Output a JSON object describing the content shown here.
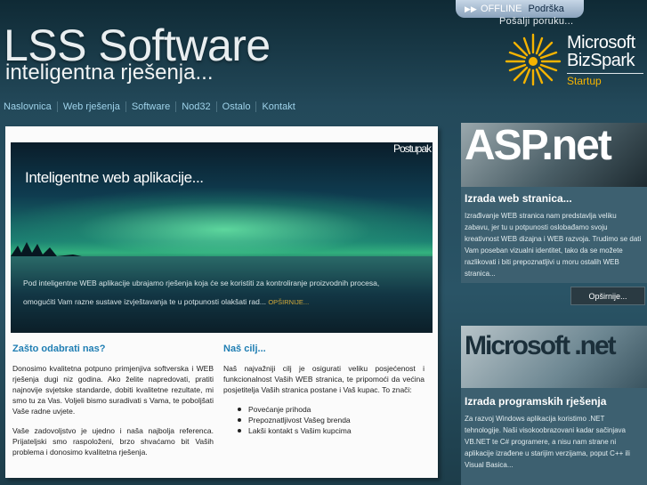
{
  "header": {
    "title": "LSS Software",
    "subtitle": "inteligentna rješenja...",
    "support": {
      "status": "OFFLINE",
      "label": "Podrška",
      "send_message": "Pošalji poruku..."
    },
    "partner": {
      "line1": "Microsoft",
      "line2": "BizSpark",
      "line3": "Startup"
    }
  },
  "nav": {
    "items": [
      "Naslovnica",
      "Web rješenja",
      "Software",
      "Nod32",
      "Ostalo",
      "Kontakt"
    ]
  },
  "slider": {
    "tab_text": "Postupak",
    "heading": "Inteligentne web aplikacije...",
    "caption_line1": "Pod inteligentne WEB aplikacije ubrajamo rješenja koja će se koristiti za kontroliranje proizvodnih procesa,",
    "caption_line2": "omogućiti Vam razne sustave izvještavanja te u potpunosti olakšati rad...",
    "more": "OPŠIRNIJE..."
  },
  "why": {
    "heading": "Zašto odabrati nas?",
    "p1": "Donosimo kvalitetna potpuno primjenjiva softverska i WEB rješenja dugi niz godina. Ako želite napredovati, pratiti najnovije svjetske standarde, dobiti kvalitetne rezultate, mi smo tu za Vas. Voljeli bismo suradivati s Vama, te poboljšati Vaše radne uvjete.",
    "p2": "Vaše zadovoljstvo je ujedno i naša najbolja referenca. Prijateljski smo raspoloženi, brzo shvaćamo bit Vaših problema i donosimo kvalitetna rješenja."
  },
  "goal": {
    "heading": "Naš cilj...",
    "p1": "Naš najvažniji cilj je osigurati veliku posjećenost i funkcionalnost Vaših WEB stranica, te pripomoći da većina posjetitelja Vaših stranica postane i Vaš kupac. To znači:",
    "list": [
      "Povećanje prihoda",
      "Prepoznatljivost Vašeg brenda",
      "Lakši kontakt s Vašim kupcima"
    ]
  },
  "aspnet": {
    "image_text": "ASP.net",
    "title": "Izrada web stranica...",
    "text": "Izrađivanje WEB stranica nam predstavlja veliku zabavu, jer tu u potpunosti oslobađamo svoju kreativnost WEB dizajna i WEB razvoja. Trudimo se dati Vam poseban vizualni identitet, tako da se možete razlikovati i biti prepoznatljivi u moru ostalih WEB stranica...",
    "button": "Opširnije..."
  },
  "dotnet": {
    "image_text": "Microsoft .net",
    "title": "Izrada programskih rješenja",
    "text": "Za razvoj Windows aplikacija koristimo .NET tehnologije. Naši visokoobrazovani kadar sačinjava VB.NET te C# programere, a nisu nam strane ni aplikacije izrađene u starijim verzijama, poput C++ ili Visual Basica..."
  }
}
